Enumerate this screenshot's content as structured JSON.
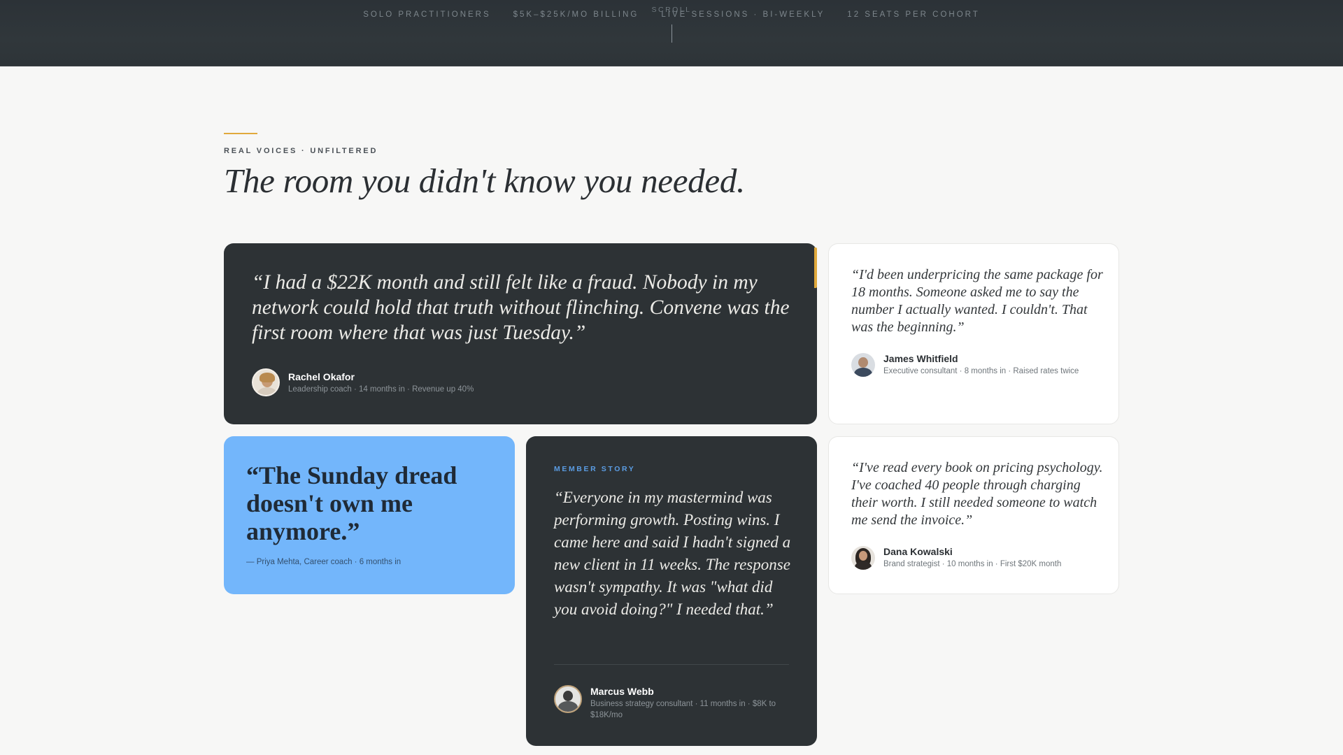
{
  "ticker": {
    "items": [
      "SOLO PRACTITIONERS",
      "$5K–$25K/MO BILLING",
      "LIVE SESSIONS · BI-WEEKLY",
      "12 SEATS PER COHORT"
    ],
    "scroll_label": "SCROLL"
  },
  "header": {
    "eyebrow": "REAL VOICES · UNFILTERED",
    "headline": "The room you didn't know you needed."
  },
  "testimonials": {
    "rachel": {
      "quote": "“I had a $22K month and still felt like a fraud. Nobody in my network could hold that truth without flinching. Convene was the first room where that was just Tuesday.”",
      "name": "Rachel Okafor",
      "meta": "Leadership coach · 14 months in · Revenue up 40%"
    },
    "james": {
      "quote": "“I'd been underpricing the same package for 18 months. Someone asked me to say the number I actually wanted. I couldn't. That was the beginning.”",
      "name": "James Whitfield",
      "meta": "Executive consultant · 8 months in · Raised rates twice"
    },
    "priya": {
      "quote": "“The Sunday dread doesn't own me anymore.”",
      "attribution": "— Priya Mehta, Career coach · 6 months in"
    },
    "marcus": {
      "eyebrow": "MEMBER STORY",
      "quote": "“Everyone in my mastermind was performing growth. Posting wins. I came here and said I hadn't signed a new client in 11 weeks. The response wasn't sympathy. It was \"what did you avoid doing?\" I needed that.”",
      "name": "Marcus Webb",
      "meta": "Business strategy consultant · 11 months in · $8K to $18K/mo"
    },
    "dana": {
      "quote": "“I've read every book on pricing psychology. I've coached 40 people through charging their worth. I still needed someone to watch me send the invoice.”",
      "name": "Dana Kowalski",
      "meta": "Brand strategist · 10 months in · First $20K month"
    }
  },
  "colors": {
    "dark_band": "#2d3337",
    "card_dark": "#2d3235",
    "card_blue": "#73b6fb",
    "accent_gold": "#e0a93c",
    "eyebrow_blue": "#5b9de4",
    "page_bg": "#f7f7f6"
  },
  "icons": {
    "avatars": [
      "avatar-rachel",
      "avatar-james",
      "avatar-marcus",
      "avatar-dana"
    ]
  }
}
